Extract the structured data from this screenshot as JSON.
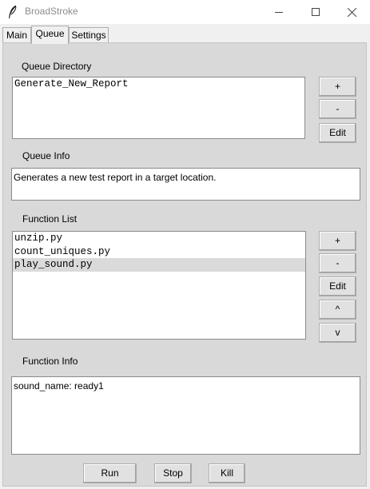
{
  "window": {
    "title": "BroadStroke",
    "icon": "feather-icon"
  },
  "tabs": [
    {
      "label": "Main",
      "active": false
    },
    {
      "label": "Queue",
      "active": true
    },
    {
      "label": "Settings",
      "active": false
    }
  ],
  "queue_directory": {
    "label": "Queue Directory",
    "items": [
      "Generate_New_Report"
    ],
    "buttons": {
      "add": "+",
      "remove": "-",
      "edit": "Edit"
    }
  },
  "queue_info": {
    "label": "Queue Info",
    "text": "Generates a new test report in a target location."
  },
  "function_list": {
    "label": "Function List",
    "items": [
      {
        "name": "unzip.py",
        "selected": false
      },
      {
        "name": "count_uniques.py",
        "selected": false
      },
      {
        "name": "play_sound.py",
        "selected": true
      }
    ],
    "buttons": {
      "add": "+",
      "remove": "-",
      "edit": "Edit",
      "up": "^",
      "down": "v"
    }
  },
  "function_info": {
    "label": "Function Info",
    "text": "sound_name: ready1"
  },
  "actions": {
    "run": "Run",
    "stop": "Stop",
    "kill": "Kill"
  }
}
